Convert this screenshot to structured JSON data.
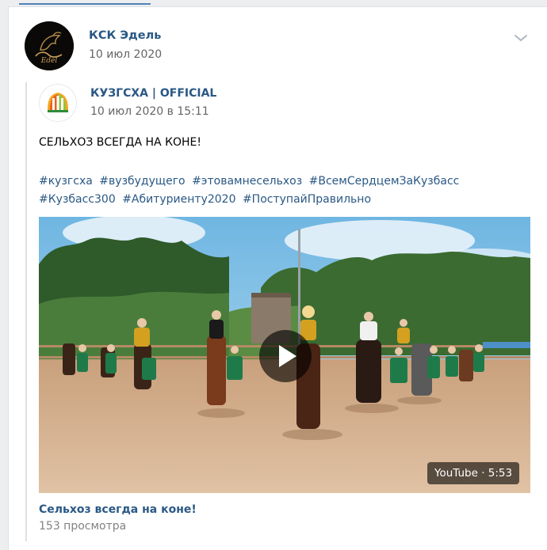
{
  "post": {
    "author_name": "КСК Эдель",
    "author_date": "10 июл 2020",
    "author_avatar_text": "Edel",
    "menu_icon": "chevron-down-icon"
  },
  "repost": {
    "source_name": "КУЗГСХА | OFFICIAL",
    "source_date": "10 июл 2020 в 15:11",
    "text": "СЕЛЬХОЗ ВСЕГДА НА КОНЕ!",
    "hashtags": [
      "#кузгсха",
      "#вузбудущего",
      "#этовамнесельхоз",
      "#ВсемСердцемЗаКузбасс",
      "#Кузбасс300",
      "#Абитуриенту2020",
      "#ПоступайПравильно"
    ]
  },
  "video": {
    "badge": "YouTube · 5:53",
    "title": "Сельхоз всегда на коне!",
    "views": "153 просмотра",
    "play_icon": "play-icon"
  },
  "colors": {
    "link": "#2a5885",
    "muted": "#656565",
    "page_bg": "#edeef0",
    "tab_accent": "#5181b8"
  }
}
